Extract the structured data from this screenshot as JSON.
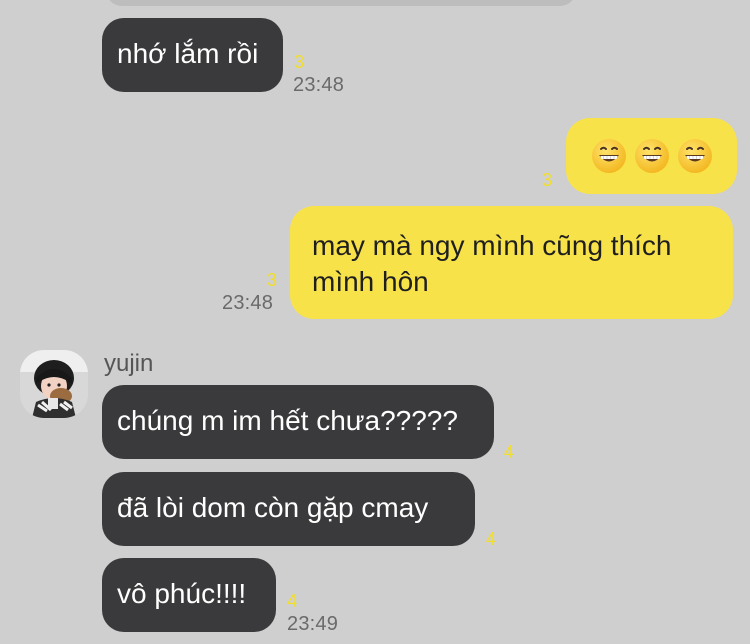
{
  "chat": {
    "messages": [
      {
        "text": "nhớ lắm rồi",
        "read_count": "3",
        "time": "23:48"
      },
      {
        "emoji_text": "😁😁😁",
        "emoji_names": [
          "grinning-face-icon",
          "grinning-face-icon",
          "grinning-face-icon"
        ],
        "read_count": "3"
      },
      {
        "line1": "may mà ngy mình cũng thích",
        "line2": "mình hôn",
        "read_count": "3",
        "time": "23:48"
      },
      {
        "sender": "yujin",
        "text": "chúng m im hết chưa?????",
        "read_count": "4"
      },
      {
        "text": "đã lòi dom còn gặp cmay",
        "read_count": "4"
      },
      {
        "text": "vô phúc!!!!",
        "read_count": "4",
        "time": "23:49"
      }
    ]
  },
  "theme": {
    "background": "#cfcfcf",
    "incoming_bubble": "#3a3a3c",
    "outgoing_bubble": "#f8e24a",
    "read_count_color": "#f3df28"
  }
}
